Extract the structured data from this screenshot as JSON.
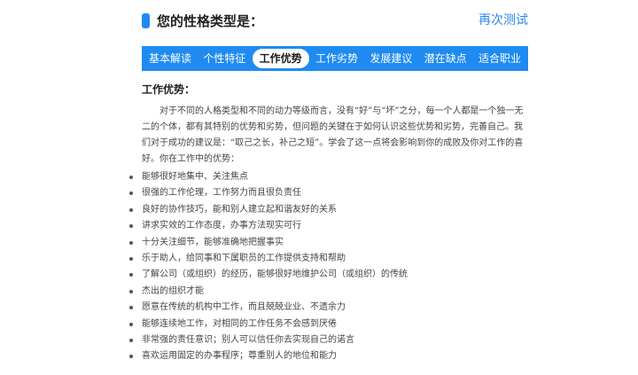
{
  "header": {
    "title": "您的性格类型是：",
    "retest_label": "再次测试"
  },
  "tabs": [
    {
      "label": "基本解读",
      "active": false
    },
    {
      "label": "个性特征",
      "active": false
    },
    {
      "label": "工作优势",
      "active": true
    },
    {
      "label": "工作劣势",
      "active": false
    },
    {
      "label": "发展建议",
      "active": false
    },
    {
      "label": "潜在缺点",
      "active": false
    },
    {
      "label": "适合职业",
      "active": false
    }
  ],
  "content": {
    "section_title": "工作优势：",
    "intro": "对于不同的人格类型和不同的动力等级而言，没有“好”与“坏”之分，每一个人都是一个独一无二的个体，都有其特别的优势和劣势，但问题的关键在于如何认识这些优势和劣势，完善自己。我们对于成功的建议是：“取己之长，补己之短”。学会了这一点将会影响到你的成败及你对工作的喜好。你在工作中的优势：",
    "points": [
      "能够很好地集中、关注焦点",
      "很强的工作伦理，工作努力而且很负责任",
      "良好的协作技巧，能和别人建立起和谐友好的关系",
      "讲求实效的工作态度，办事方法现实可行",
      "十分关注细节，能够准确地把握事实",
      "乐于助人，给同事和下属职员的工作提供支持和帮助",
      "了解公司（或组织）的经历，能够很好地维护公司（或组织）的传统",
      "杰出的组织才能",
      "愿意在传统的机构中工作，而且兢兢业业、不遗余力",
      "能够连续地工作，对相同的工作任务不会感到厌倦",
      "非常强的责任意识；别人可以信任你去实现自己的诺言",
      "喜欢运用固定的办事程序；尊重别人的地位和能力"
    ]
  },
  "colors": {
    "accent": "#1f8bf0",
    "link": "#2a86ee"
  }
}
